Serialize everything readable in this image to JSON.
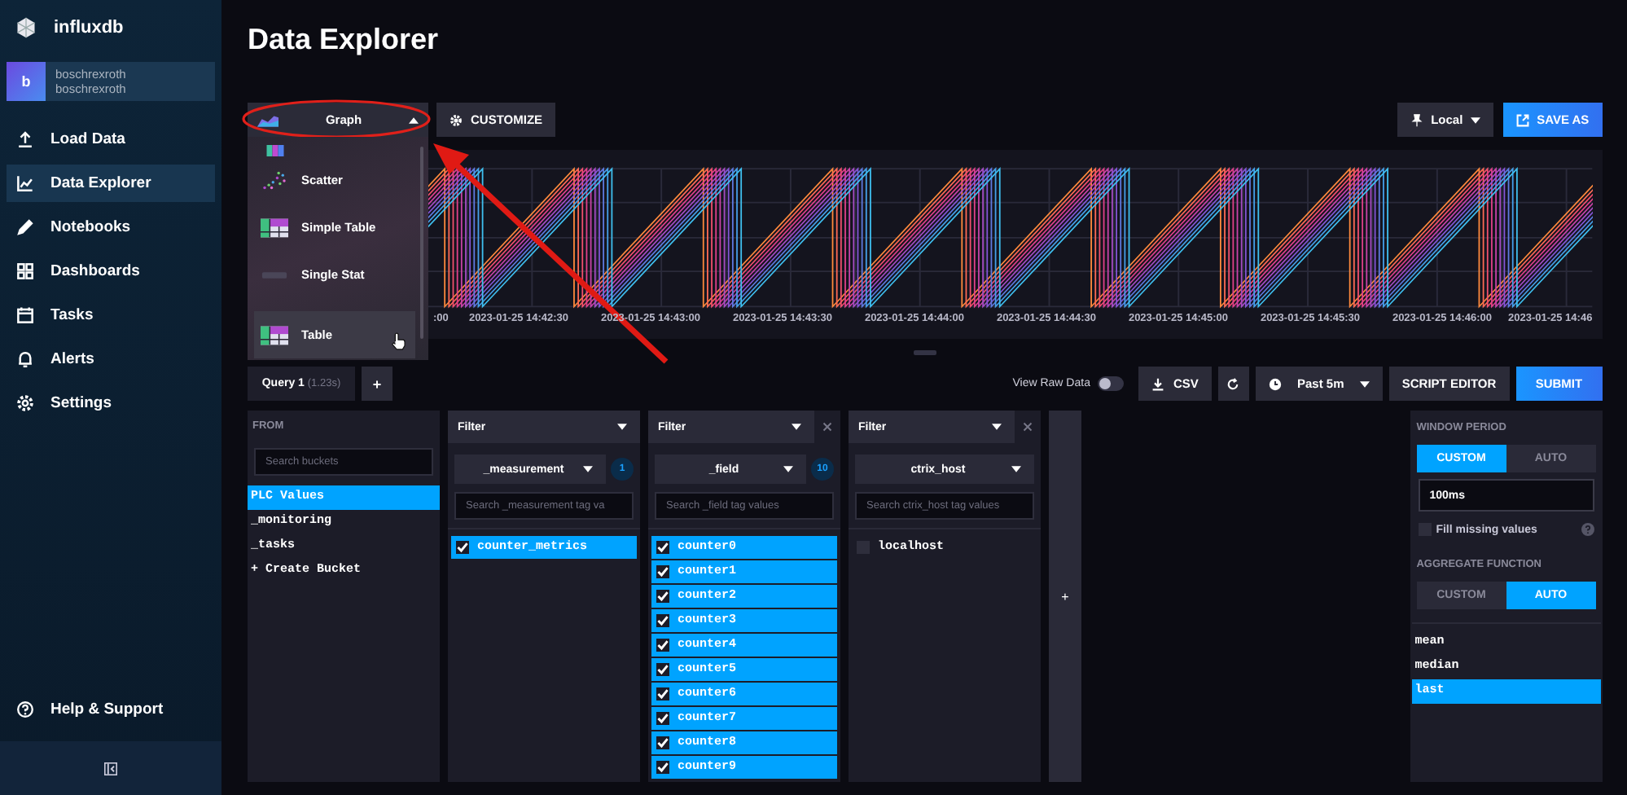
{
  "brand": {
    "name": "influxdb"
  },
  "account": {
    "initial": "b",
    "org": "boschrexroth",
    "user": "boschrexroth"
  },
  "nav": [
    {
      "label": "Load Data",
      "kind": "upload",
      "selected": false
    },
    {
      "label": "Data Explorer",
      "kind": "chart",
      "selected": true
    },
    {
      "label": "Notebooks",
      "kind": "pencil",
      "selected": false
    },
    {
      "label": "Dashboards",
      "kind": "grid",
      "selected": false
    },
    {
      "label": "Tasks",
      "kind": "calendar",
      "selected": false
    },
    {
      "label": "Alerts",
      "kind": "bell",
      "selected": false
    },
    {
      "label": "Settings",
      "kind": "gear",
      "selected": false
    }
  ],
  "help": {
    "label": "Help & Support"
  },
  "page_title": "Data Explorer",
  "visualization": {
    "label": "Graph",
    "expanded": true,
    "options": [
      {
        "label": "Scatter",
        "kind": "scatter",
        "hovered": false
      },
      {
        "label": "Simple Table",
        "kind": "table",
        "hovered": false
      },
      {
        "label": "Single Stat",
        "kind": "stat",
        "hovered": false
      },
      {
        "label": "Table",
        "kind": "table",
        "hovered": true
      }
    ]
  },
  "customize": "CUSTOMIZE",
  "time_zone": "Local",
  "save_as": "SAVE AS",
  "graph": {
    "x_labels": [
      ":00",
      "2023-01-25 14:42:30",
      "2023-01-25 14:43:00",
      "2023-01-25 14:43:30",
      "2023-01-25 14:44:00",
      "2023-01-25 14:44:30",
      "2023-01-25 14:45:00",
      "2023-01-25 14:45:30",
      "2023-01-25 14:46:00",
      "2023-01-25 14:46"
    ]
  },
  "query_tabs": [
    {
      "name": "Query 1",
      "duration": "(1.23s)",
      "selected": true
    }
  ],
  "add_query": "+",
  "view_raw": {
    "label": "View Raw Data",
    "on": false
  },
  "csv": "CSV",
  "time_range": "Past 5m",
  "script_editor": "SCRIPT EDITOR",
  "submit": "SUBMIT",
  "from": {
    "title": "FROM",
    "placeholder": "Search buckets",
    "buckets": [
      {
        "name": "PLC Values",
        "selected": true
      },
      {
        "name": "_monitoring",
        "selected": false
      },
      {
        "name": "_tasks",
        "selected": false
      }
    ],
    "create": "+ Create Bucket"
  },
  "filters": [
    {
      "title": "Filter",
      "removable": false,
      "key": "_measurement",
      "count": "1",
      "placeholder": "Search _measurement tag va",
      "values": [
        {
          "name": "counter_metrics",
          "checked": true
        }
      ]
    },
    {
      "title": "Filter",
      "removable": true,
      "key": "_field",
      "count": "10",
      "placeholder": "Search _field tag values",
      "values": [
        {
          "name": "counter0",
          "checked": true
        },
        {
          "name": "counter1",
          "checked": true
        },
        {
          "name": "counter2",
          "checked": true
        },
        {
          "name": "counter3",
          "checked": true
        },
        {
          "name": "counter4",
          "checked": true
        },
        {
          "name": "counter5",
          "checked": true
        },
        {
          "name": "counter6",
          "checked": true
        },
        {
          "name": "counter7",
          "checked": true
        },
        {
          "name": "counter8",
          "checked": true
        },
        {
          "name": "counter9",
          "checked": true
        }
      ]
    },
    {
      "title": "Filter",
      "removable": true,
      "key": "ctrix_host",
      "placeholder": "Search ctrix_host tag values",
      "values": [
        {
          "name": "localhost",
          "checked": false
        }
      ]
    }
  ],
  "add_filter": "+",
  "window_period": {
    "title": "WINDOW PERIOD",
    "modes": [
      {
        "label": "CUSTOM",
        "selected": true
      },
      {
        "label": "AUTO",
        "selected": false
      }
    ],
    "value": "100ms",
    "fill_missing": {
      "label": "Fill missing values",
      "checked": false
    }
  },
  "aggregate": {
    "title": "AGGREGATE FUNCTION",
    "modes": [
      {
        "label": "CUSTOM",
        "selected": false
      },
      {
        "label": "AUTO",
        "selected": true
      }
    ],
    "functions": [
      {
        "name": "mean",
        "selected": false
      },
      {
        "name": "median",
        "selected": false
      },
      {
        "name": "last",
        "selected": true
      }
    ]
  }
}
